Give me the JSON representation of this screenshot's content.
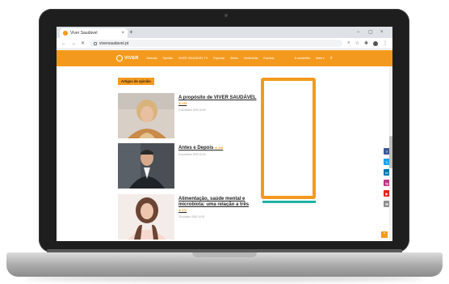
{
  "browser": {
    "tab_title": "Viver Saudável",
    "tab_close": "×",
    "new_tab": "+",
    "minimize": "–",
    "maximize": "▢",
    "close": "×",
    "back": "←",
    "forward": "→",
    "reload": "✕",
    "url": "viversaudavel.pt",
    "search_icon": "search-icon",
    "star_icon": "star-icon"
  },
  "site": {
    "logo": "VIVER",
    "menu": [
      "Notícias",
      "Opinião",
      "VIVER SAUDÁVEL TV",
      "Especial",
      "Séries",
      "Multimédia",
      "Eventos"
    ],
    "menu_right": [
      "A newsletter",
      "Mais ▾"
    ],
    "accent": "#f39a1e",
    "teal": "#1fb3a2"
  },
  "section": {
    "label": "Artigos de opinião"
  },
  "articles": [
    {
      "title": "A propósito de VIVER SAUDÁVEL",
      "badge": "★ 448",
      "date": "6 novembro 2020 10:00"
    },
    {
      "title": "Antes e Depois",
      "badge": "★ 448",
      "date": "6 novembro 2020 10:00"
    },
    {
      "title": "Alimentação, saúde mental e microbiota: uma relação a três",
      "badge": "★ 172",
      "date": "16 outubro 2020 10:15"
    }
  ],
  "share": [
    {
      "label": "f",
      "color": "#3b5998"
    },
    {
      "label": "t",
      "color": "#1da1f2"
    },
    {
      "label": "in",
      "color": "#0077b5"
    },
    {
      "label": "ig",
      "color": "#c13584"
    },
    {
      "label": "▶",
      "color": "#e62117"
    },
    {
      "label": "✉",
      "color": "#8e8e8e"
    }
  ],
  "back_to_top": "^"
}
